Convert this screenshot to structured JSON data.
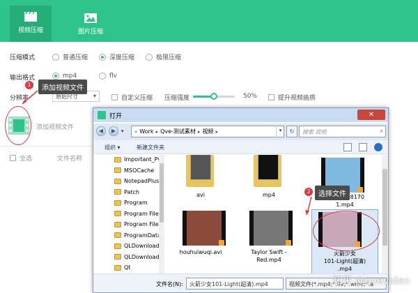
{
  "header": {
    "tabs": [
      {
        "label": "视频压缩",
        "active": true
      },
      {
        "label": "图片压缩",
        "active": false
      }
    ],
    "accent": "#2dc38a"
  },
  "settings": {
    "mode_label": "压缩模式",
    "mode_options": [
      "普通压缩",
      "深度压缩",
      "极限压缩"
    ],
    "mode_selected": "深度压缩",
    "format_label": "输出格式",
    "format_options": [
      "mp4",
      "flv"
    ],
    "format_selected": "mp4",
    "resolution_label": "分辨率",
    "resolution_value": "原始尺寸",
    "custom_compress_label": "自定义压缩",
    "strength_label": "压缩强度",
    "strength_value": "50%",
    "strength_fraction": 0.5,
    "enhance_label": "提升视频画质"
  },
  "add_area": {
    "add_label": "添加视频文件",
    "select_all_label": "全选",
    "filename_col": "文件名称"
  },
  "annotations": {
    "tip1_number": "1",
    "tip1_text": "添加视频文件",
    "tip2_number": "2",
    "tip2_text": "选择文件",
    "color": "#e0393e"
  },
  "dialog": {
    "title": "打开",
    "breadcrumb": [
      "Work",
      "Qve-测试素材",
      "视频"
    ],
    "search_placeholder": "搜索 视频",
    "toolbar": {
      "organize": "组织 ▾",
      "new_folder": "新建文件夹"
    },
    "tree_items": [
      "Important_Pw",
      "MSOCache",
      "NotepadPlusP",
      "Patch",
      "Program",
      "Program Files",
      "Program Files",
      "ProgramData",
      "QLDownload",
      "QLDownloadG",
      "Qt"
    ],
    "files": [
      {
        "name": "avi",
        "kind": "folder"
      },
      {
        "name": "mp4",
        "kind": "folder"
      },
      {
        "name": "20190328170\n1.mp4",
        "kind": "video"
      },
      {
        "name": "houhuiwuqi.avi",
        "kind": "video"
      },
      {
        "name": "Taylor Swift -\nRed.mp4",
        "kind": "video"
      },
      {
        "name": "火箭少女\n101-Light(超清)\n.mp4",
        "kind": "video",
        "selected": true
      }
    ],
    "filename_label": "文件名(N):",
    "filename_value": "火箭少女101-Light(超清).mp4",
    "filetype_value": "视频文件(*.mp4;*.flv;*.wmv;*.a"
  },
  "watermark": "知乎 @qvevideo"
}
